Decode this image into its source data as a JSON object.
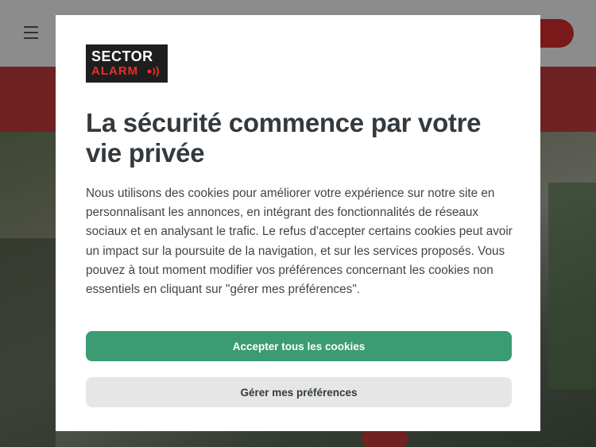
{
  "logo": {
    "line1": "SECTOR",
    "line2": "ALARM",
    "colors": {
      "bg": "#1e1e1e",
      "accent": "#e8302c"
    }
  },
  "dialog": {
    "title": "La sécurité commence par votre vie privée",
    "body": "Nous utilisons des cookies pour améliorer votre expérience sur notre site en personnalisant les annonces, en intégrant des fonctionnalités de réseaux sociaux et en analysant le trafic. Le refus d'accepter certains cookies peut avoir un impact sur la poursuite de la navigation, et sur les services proposés. Vous pouvez à tout moment modifier vos préférences concernant les cookies non essentiels en cliquant sur \"gérer mes préférences\".",
    "accept_label": "Accepter tous les cookies",
    "manage_label": "Gérer mes préférences"
  },
  "colors": {
    "accept_bg": "#3b9b73",
    "manage_bg": "#e6e6e6",
    "brand_red": "#d22c2c"
  },
  "background": {
    "menu_icon": "hamburger-icon"
  }
}
